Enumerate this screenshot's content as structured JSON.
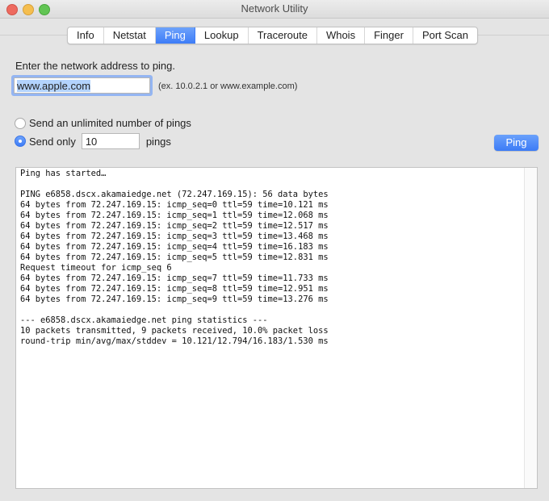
{
  "window": {
    "title": "Network Utility"
  },
  "tabs": [
    {
      "label": "Info",
      "active": false
    },
    {
      "label": "Netstat",
      "active": false
    },
    {
      "label": "Ping",
      "active": true
    },
    {
      "label": "Lookup",
      "active": false
    },
    {
      "label": "Traceroute",
      "active": false
    },
    {
      "label": "Whois",
      "active": false
    },
    {
      "label": "Finger",
      "active": false
    },
    {
      "label": "Port Scan",
      "active": false
    }
  ],
  "ping": {
    "prompt": "Enter the network address to ping.",
    "address_value": "www.apple.com",
    "address_hint": "(ex. 10.0.2.1 or www.example.com)",
    "option_unlimited": "Send an unlimited number of pings",
    "option_send_only": "Send only",
    "selected_option": "send_only",
    "count_value": "10",
    "count_suffix": "pings",
    "button_label": "Ping"
  },
  "output": {
    "lines": [
      "Ping has started…",
      "",
      "PING e6858.dscx.akamaiedge.net (72.247.169.15): 56 data bytes",
      "64 bytes from 72.247.169.15: icmp_seq=0 ttl=59 time=10.121 ms",
      "64 bytes from 72.247.169.15: icmp_seq=1 ttl=59 time=12.068 ms",
      "64 bytes from 72.247.169.15: icmp_seq=2 ttl=59 time=12.517 ms",
      "64 bytes from 72.247.169.15: icmp_seq=3 ttl=59 time=13.468 ms",
      "64 bytes from 72.247.169.15: icmp_seq=4 ttl=59 time=16.183 ms",
      "64 bytes from 72.247.169.15: icmp_seq=5 ttl=59 time=12.831 ms",
      "Request timeout for icmp_seq 6",
      "64 bytes from 72.247.169.15: icmp_seq=7 ttl=59 time=11.733 ms",
      "64 bytes from 72.247.169.15: icmp_seq=8 ttl=59 time=12.951 ms",
      "64 bytes from 72.247.169.15: icmp_seq=9 ttl=59 time=13.276 ms",
      "",
      "--- e6858.dscx.akamaiedge.net ping statistics ---",
      "10 packets transmitted, 9 packets received, 10.0% packet loss",
      "round-trip min/avg/max/stddev = 10.121/12.794/16.183/1.530 ms"
    ]
  }
}
